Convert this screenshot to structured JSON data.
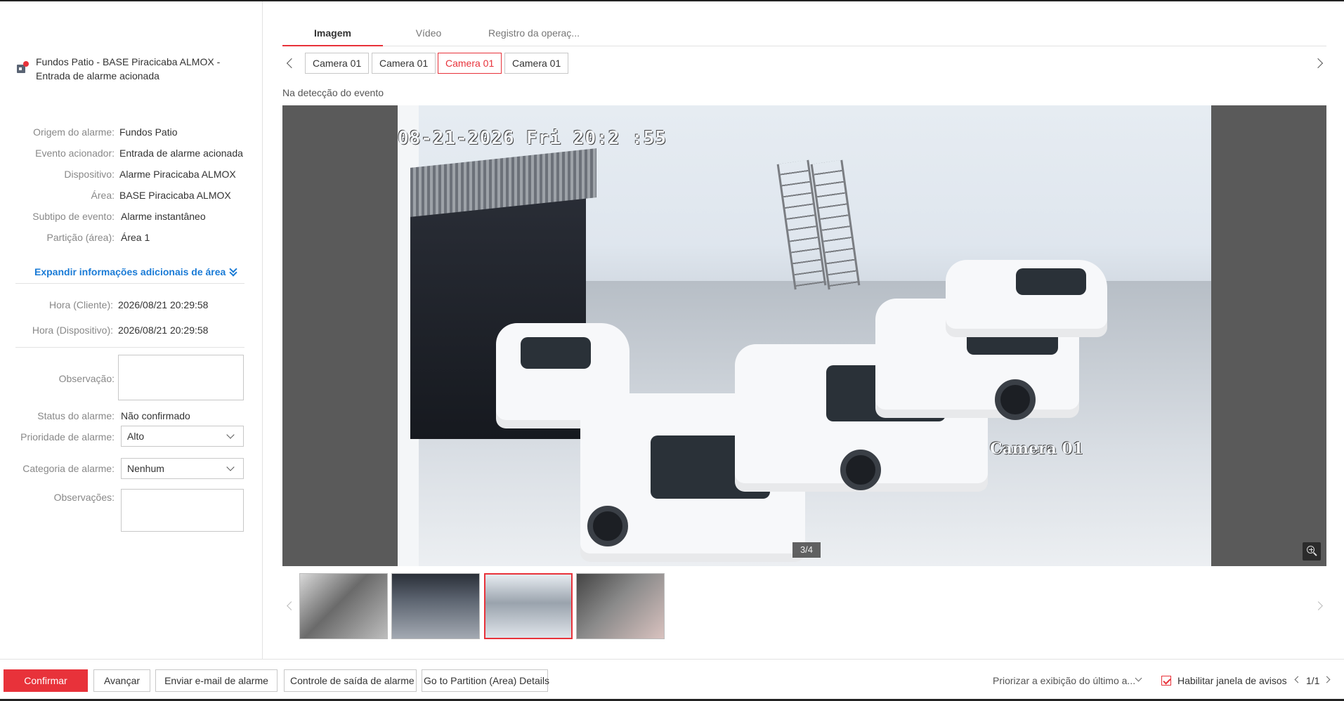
{
  "alarm": {
    "title_line1": "Fundos Patio - BASE Piracicaba ALMOX -",
    "title_line2": "Entrada de alarme acionada"
  },
  "details": [
    {
      "label": "Origem do alarme:",
      "value": "Fundos Patio"
    },
    {
      "label": "Evento acionador:",
      "value": "Entrada de alarme acionada"
    },
    {
      "label": "Dispositivo:",
      "value": "Alarme Piracicaba ALMOX"
    },
    {
      "label": "Área:",
      "value": "BASE Piracicaba ALMOX"
    },
    {
      "label": "Subtipo de evento:",
      "value": "Alarme instantâneo"
    },
    {
      "label": "Partição (área):",
      "value": "Área 1"
    }
  ],
  "expand_link": "Expandir informações adicionais de área",
  "times": [
    {
      "label": "Hora (Cliente):",
      "value": "2026/08/21 20:29:58"
    },
    {
      "label": "Hora (Dispositivo):",
      "value": "2026/08/21 20:29:58"
    }
  ],
  "form": {
    "observacao_label": "Observação:",
    "status_label": "Status do alarme:",
    "status_value": "Não confirmado",
    "prioridade_label": "Prioridade de alarme:",
    "prioridade_value": "Alto",
    "categoria_label": "Categoria de alarme:",
    "categoria_value": "Nenhum",
    "observacoes_label": "Observações:"
  },
  "tabs": [
    "Imagem",
    "Vídeo",
    "Registro da operaç..."
  ],
  "cameras": [
    "Camera 01",
    "Camera 01",
    "Camera 01",
    "Camera 01"
  ],
  "detection_label": "Na detecção do evento",
  "image": {
    "osd_time": "08-21-2026 Fri 20:2 :55",
    "osd_name": "Camera 01",
    "counter": "3/4"
  },
  "bottom": {
    "confirm": "Confirmar",
    "advance": "Avançar",
    "email": "Enviar e-mail de alarme",
    "output": "Controle de saída de alarme",
    "partition": "Go to Partition (Area) Details",
    "priority_display": "Priorizar a exibição do último a...",
    "enable_popup": "Habilitar janela de avisos",
    "pager": "1/1"
  },
  "colors": {
    "accent": "#e8323a",
    "link": "#1a7bd6"
  }
}
